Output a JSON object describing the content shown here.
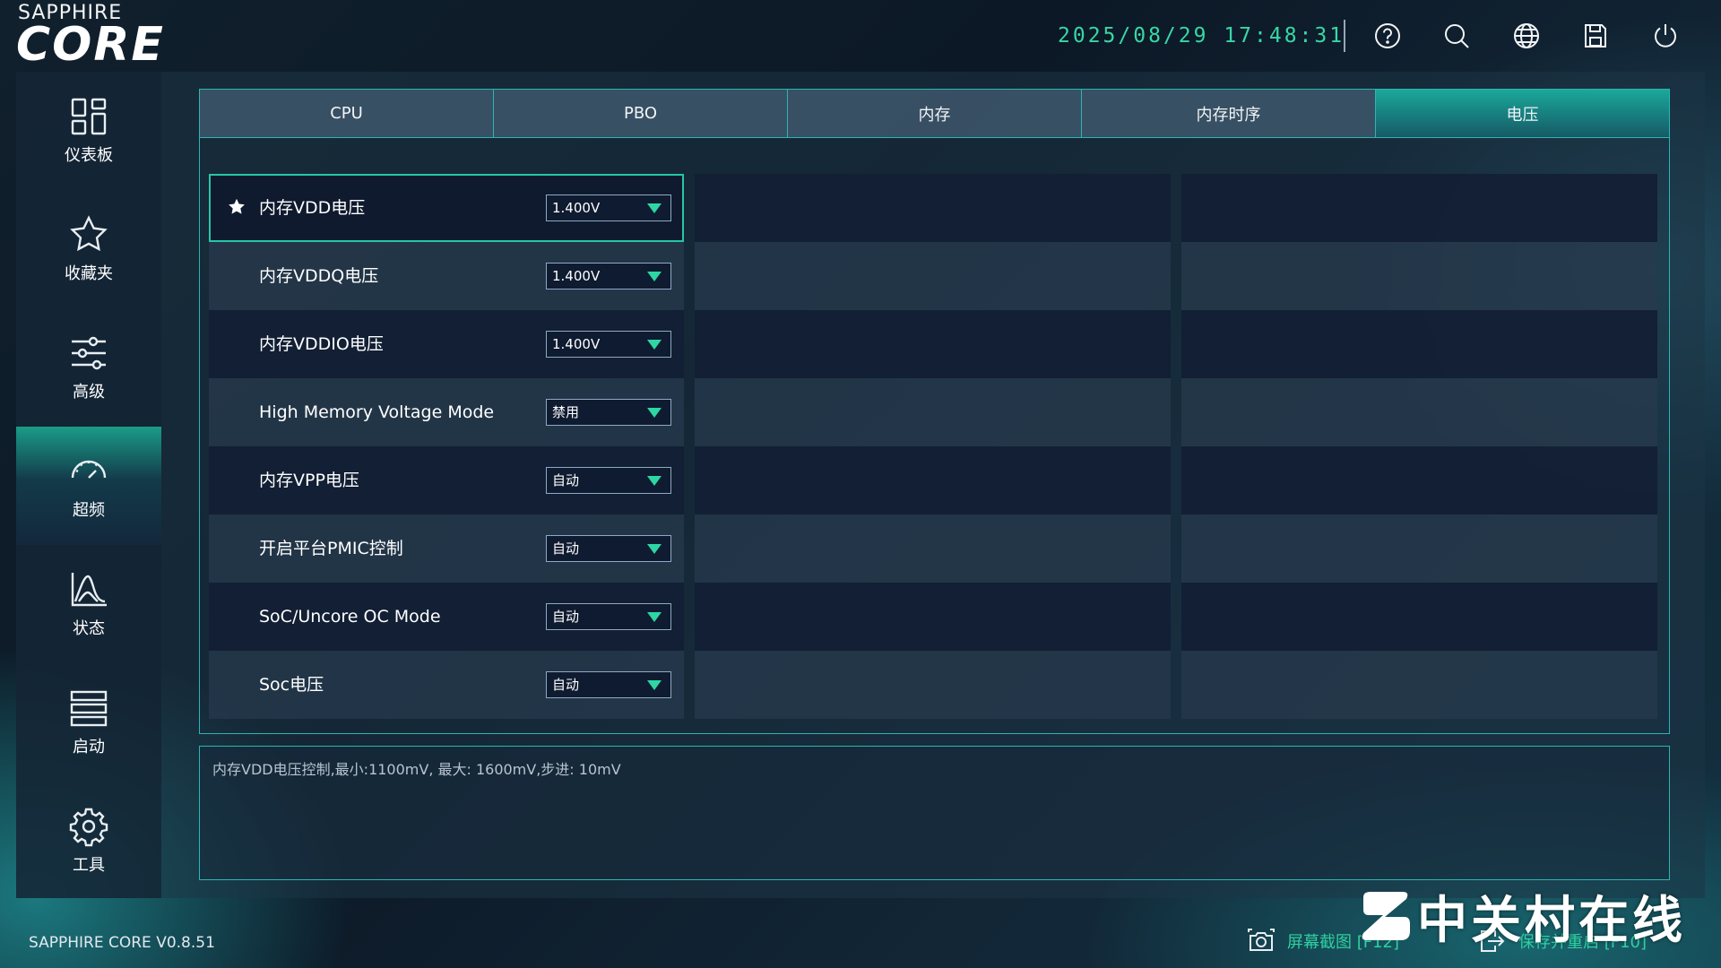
{
  "app": {
    "logo_small": "SAPPHIRE",
    "logo_big": "CORE",
    "version": "SAPPHIRE CORE V0.8.51"
  },
  "header": {
    "datetime": "2025/08/29 17:48:31",
    "icons": [
      "help-icon",
      "search-icon",
      "globe-icon",
      "save-icon",
      "power-icon"
    ]
  },
  "sidebar": {
    "items": [
      {
        "label": "仪表板",
        "icon": "dashboard-icon"
      },
      {
        "label": "收藏夹",
        "icon": "star-icon"
      },
      {
        "label": "高级",
        "icon": "sliders-icon"
      },
      {
        "label": "超频",
        "icon": "speedometer-icon",
        "active": true
      },
      {
        "label": "状态",
        "icon": "chart-icon"
      },
      {
        "label": "启动",
        "icon": "boot-list-icon"
      },
      {
        "label": "工具",
        "icon": "gear-icon"
      }
    ]
  },
  "tabs": [
    {
      "label": "CPU"
    },
    {
      "label": "PBO"
    },
    {
      "label": "内存"
    },
    {
      "label": "内存时序"
    },
    {
      "label": "电压",
      "active": true
    }
  ],
  "settings": [
    {
      "label": "内存VDD电压",
      "value": "1.400V",
      "favorite": true,
      "selected": true
    },
    {
      "label": "内存VDDQ电压",
      "value": "1.400V"
    },
    {
      "label": "内存VDDIO电压",
      "value": "1.400V"
    },
    {
      "label": "High Memory Voltage Mode",
      "value": "禁用"
    },
    {
      "label": "内存VPP电压",
      "value": "自动"
    },
    {
      "label": "开启平台PMIC控制",
      "value": "自动"
    },
    {
      "label": "SoC/Uncore OC Mode",
      "value": "自动"
    },
    {
      "label": "Soc电压",
      "value": "自动"
    }
  ],
  "description": "内存VDD电压控制,最小:1100mV, 最大: 1600mV,步进: 10mV",
  "footer": {
    "screenshot": "屏幕截图 [F12]",
    "save_restart": "保存并重启 [F10]"
  },
  "watermark": "中关村在线",
  "colors": {
    "accent": "#2ed6a4",
    "border": "#2ab6b2",
    "datetime": "#38d7a6"
  }
}
